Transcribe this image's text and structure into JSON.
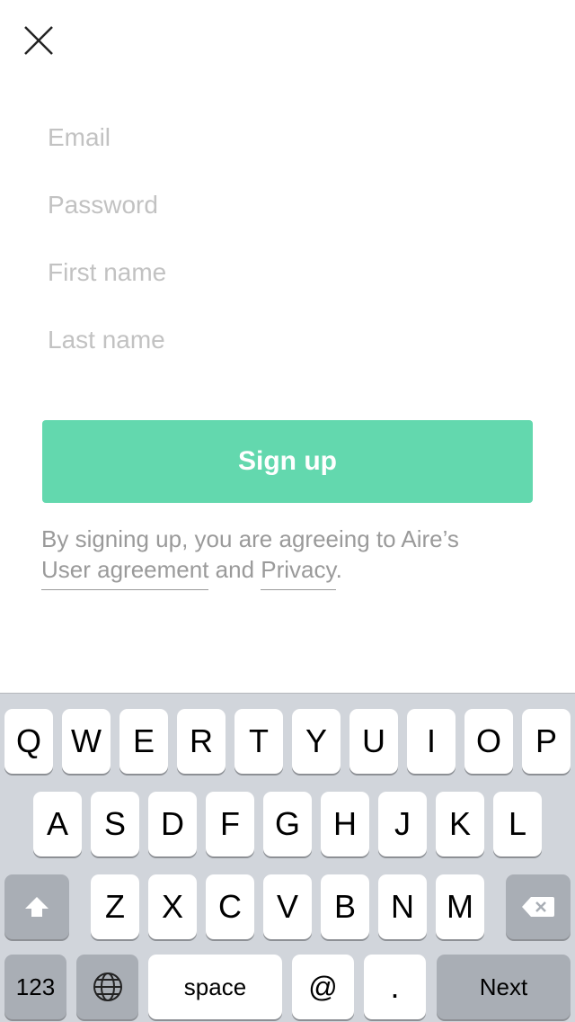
{
  "form": {
    "email_placeholder": "Email",
    "password_placeholder": "Password",
    "first_name_placeholder": "First name",
    "last_name_placeholder": "Last name",
    "signup_label": "Sign up"
  },
  "terms": {
    "prefix": "By signing up, you are agreeing to Aire’s",
    "user_agreement": "User agreement",
    "and": "and",
    "privacy": "Privacy",
    "suffix": "."
  },
  "keyboard": {
    "row1": [
      "Q",
      "W",
      "E",
      "R",
      "T",
      "Y",
      "U",
      "I",
      "O",
      "P"
    ],
    "row2": [
      "A",
      "S",
      "D",
      "F",
      "G",
      "H",
      "J",
      "K",
      "L"
    ],
    "row3": [
      "Z",
      "X",
      "C",
      "V",
      "B",
      "N",
      "M"
    ],
    "numbers_label": "123",
    "space_label": "space",
    "at_label": "@",
    "period_label": ".",
    "next_label": "Next"
  },
  "colors": {
    "accent": "#63d8ae",
    "placeholder": "#c2c2c2",
    "keyboard_bg": "#d1d5db"
  },
  "icons": [
    "close-icon",
    "shift-icon",
    "delete-icon",
    "globe-icon"
  ]
}
